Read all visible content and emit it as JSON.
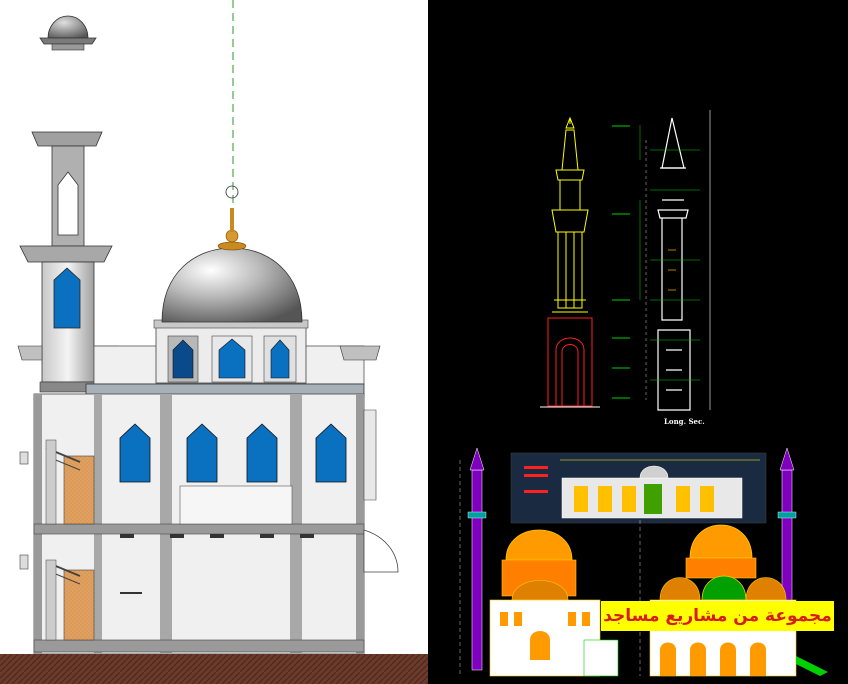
{
  "caption": {
    "text": "مجموعة من مشاريع مساجد"
  },
  "minaret_section_label": {
    "text": "Long. Sec."
  },
  "colors": {
    "caption_background": "#ffff00",
    "caption_text": "#d81b1b",
    "cad_background": "#000000",
    "dome_gray": "#9a9a9a",
    "window_blue": "#0a70c0",
    "wall_light": "#f0f0f0",
    "column_gray": "#a8a8a8",
    "cad_yellow": "#ffff00",
    "cad_red": "#ff2020",
    "cad_purple": "#8000c0",
    "cad_orange": "#ff9a00",
    "cad_green": "#00d000"
  }
}
